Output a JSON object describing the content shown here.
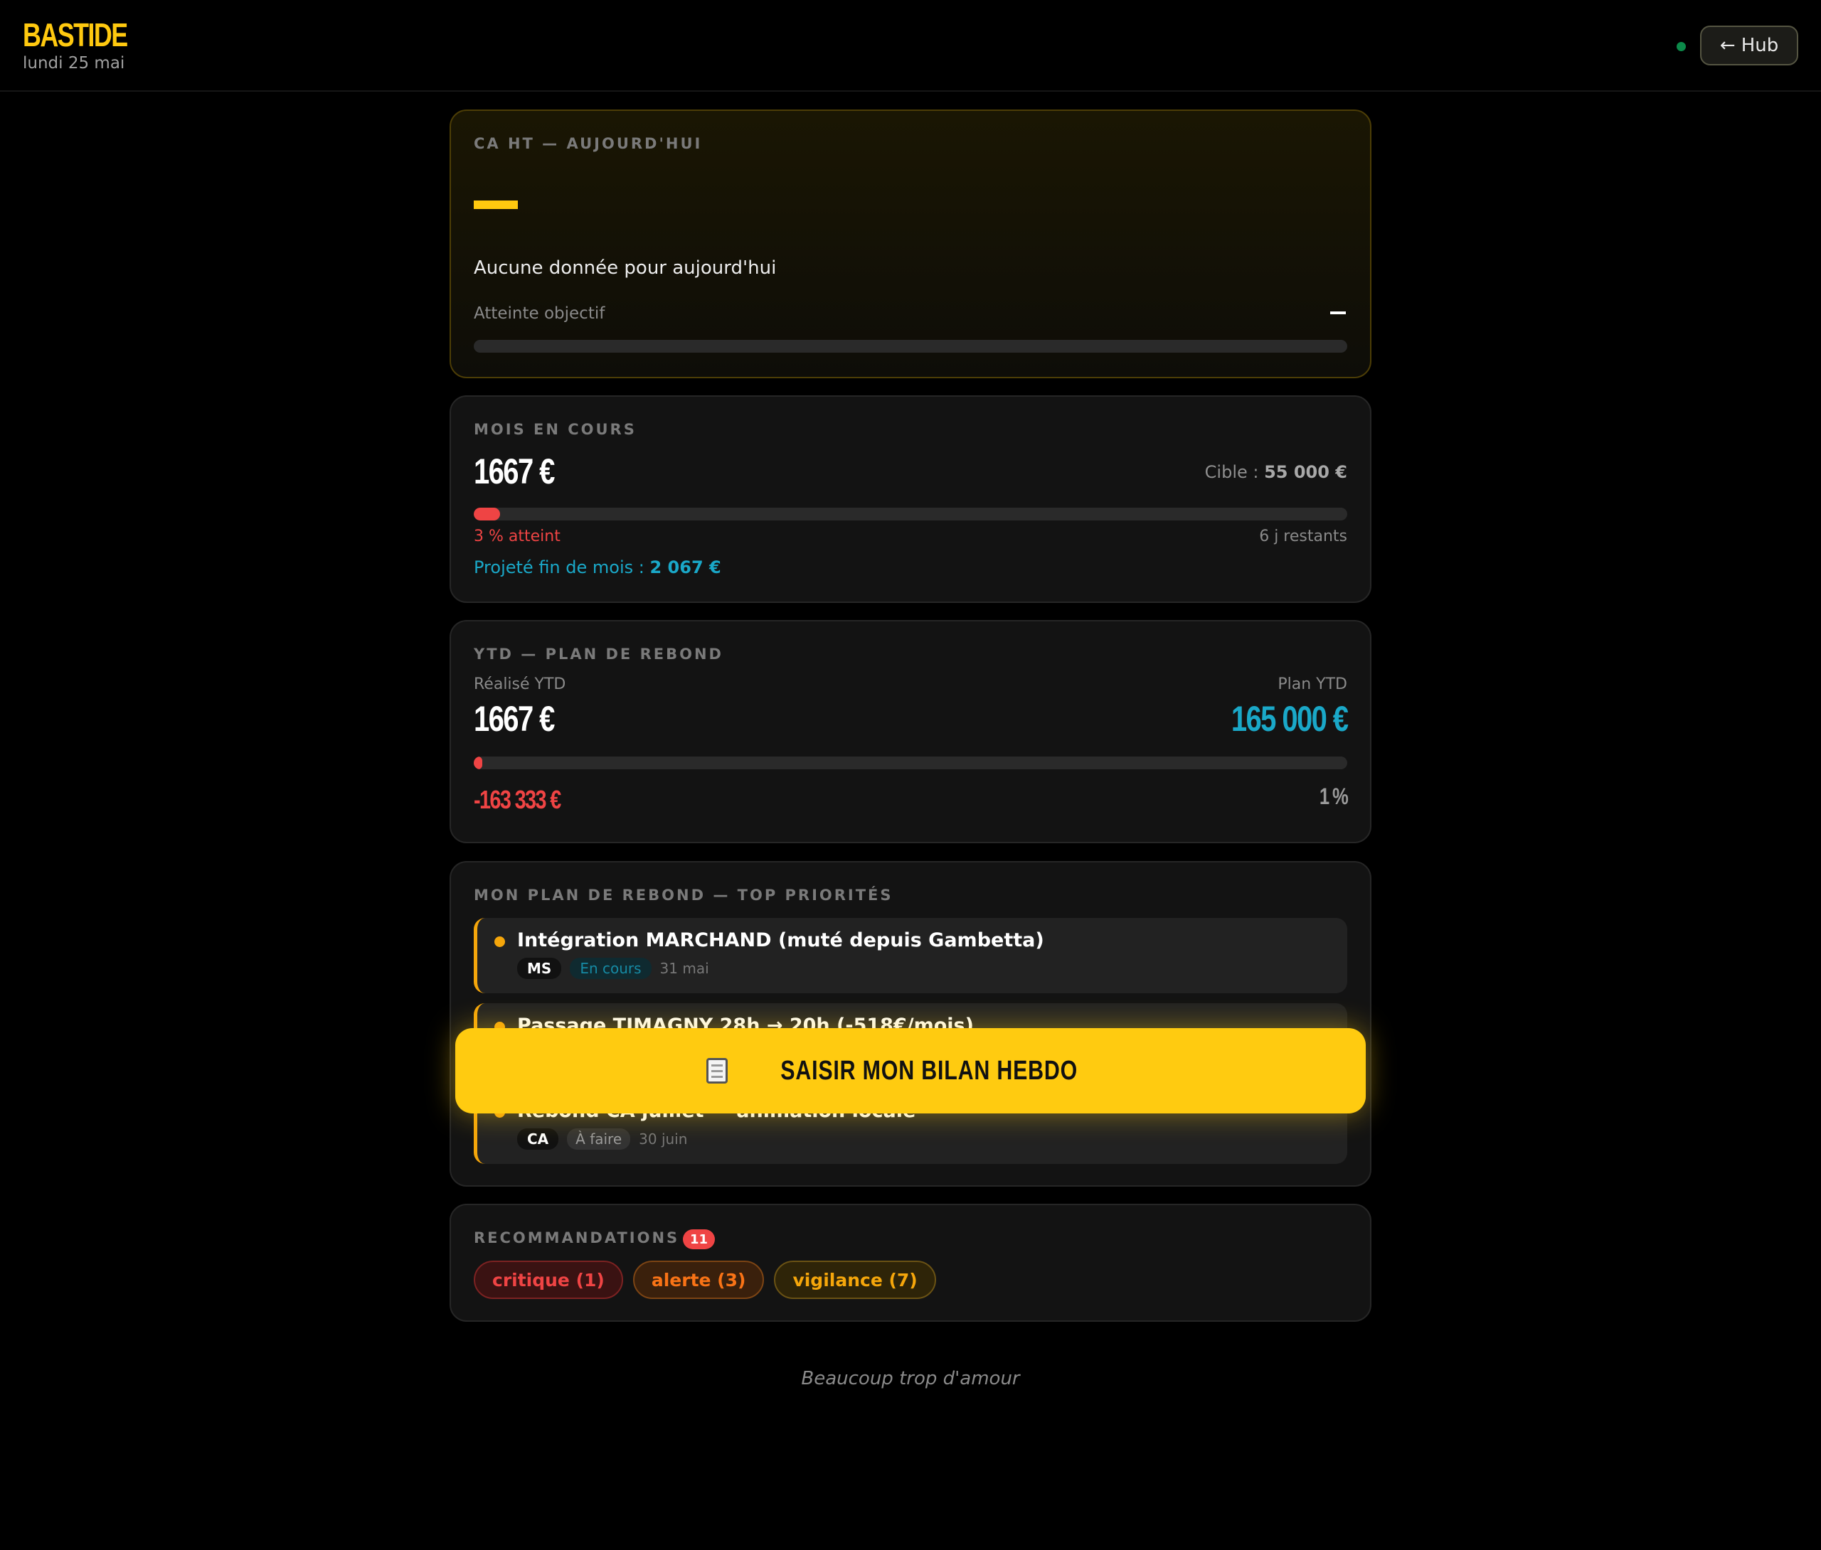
{
  "header": {
    "brand": "BASTIDE",
    "date": "lundi 25 mai",
    "hub_label": "← Hub",
    "status_color": "#0c8a4a"
  },
  "today": {
    "label": "CA HT — AUJOURD'HUI",
    "empty_message": "Aucune donnée pour aujourd'hui",
    "objective_label": "Atteinte objectif"
  },
  "month": {
    "label": "MOIS EN COURS",
    "value": "1667 €",
    "target_prefix": "Cible : ",
    "target_value": "55 000 €",
    "progress_pct": 3,
    "reached": "3 % atteint",
    "days_left": "6 j restants",
    "projected_prefix": "Projeté fin de mois : ",
    "projected_value": "2 067 €"
  },
  "ytd": {
    "label": "YTD — PLAN DE REBOND",
    "realised_label": "Réalisé YTD",
    "realised_value": "1667 €",
    "plan_label": "Plan YTD",
    "plan_value": "165 000 €",
    "progress_pct": 1,
    "gap_value": "-163 333 €",
    "pct_value": "1 %"
  },
  "plan": {
    "label": "MON PLAN DE REBOND — TOP PRIORITÉS",
    "items": [
      {
        "title": "Intégration MARCHAND (muté depuis Gambetta)",
        "who": "MS",
        "state": "En cours",
        "due": "31 mai"
      },
      {
        "title": "Passage TIMAGNY 28h → 20h (-518€/mois)",
        "who": "",
        "state": "",
        "due": ""
      },
      {
        "title": "Rebond CA juillet — animation locale",
        "who": "CA",
        "state": "À faire",
        "due": "30 juin"
      }
    ]
  },
  "cta": {
    "label": "SAISIR MON BILAN HEBDO",
    "icon": "clipboard-icon"
  },
  "reco": {
    "label": "RECOMMANDATIONS",
    "count": "11",
    "chips": [
      {
        "label": "critique (1)",
        "color": "#ef4444"
      },
      {
        "label": "alerte (3)",
        "color": "#f97316"
      },
      {
        "label": "vigilance (7)",
        "color": "#f5a60b"
      }
    ]
  },
  "footer": {
    "quote": "Beaucoup trop d'amour"
  }
}
